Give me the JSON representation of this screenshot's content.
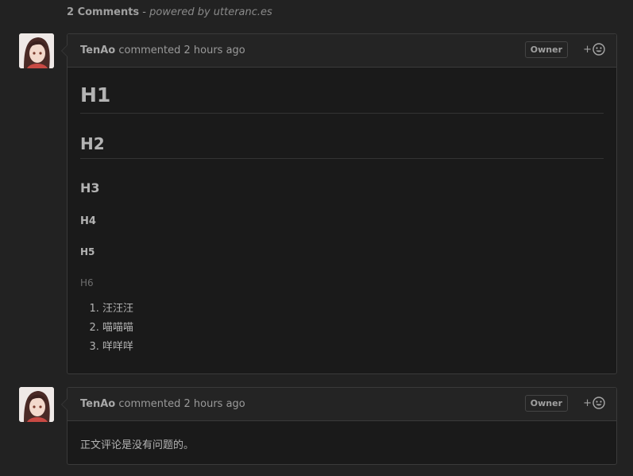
{
  "header": {
    "count": "2 Comments",
    "separator": " - ",
    "powered": "powered by utteranc.es"
  },
  "comments": [
    {
      "author": "TenAo",
      "meta": " commented 2 hours ago",
      "badge": "Owner",
      "reaction_plus": "+",
      "body": {
        "h1": "H1",
        "h2": "H2",
        "h3": "H3",
        "h4": "H4",
        "h5": "H5",
        "h6": "H6",
        "list": [
          "汪汪汪",
          "喵喵喵",
          "咩咩咩"
        ]
      }
    },
    {
      "author": "TenAo",
      "meta": " commented 2 hours ago",
      "badge": "Owner",
      "reaction_plus": "+",
      "text": "正文评论是没有问题的。"
    }
  ],
  "colors": {
    "background": "#222222",
    "card": "#1a1a1a",
    "card_header": "#242424",
    "border": "#3a3a3a"
  },
  "icons": {
    "reaction": "smiley-icon"
  }
}
